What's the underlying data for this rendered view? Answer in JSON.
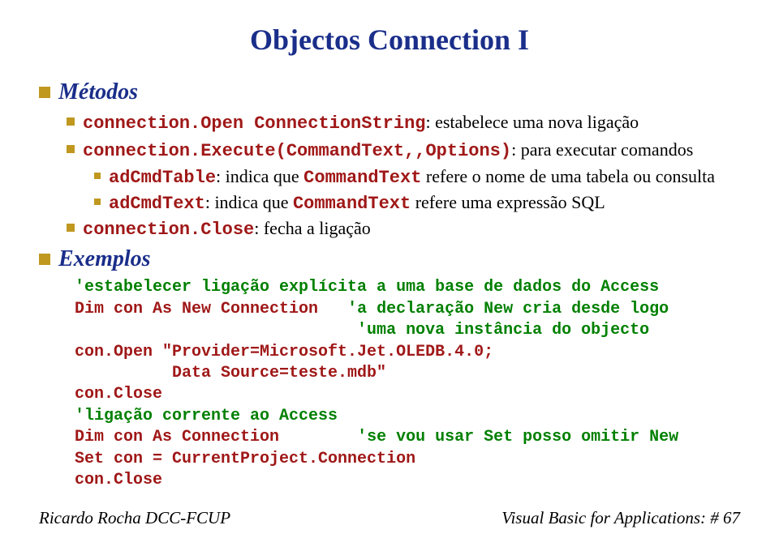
{
  "title": "Objectos Connection I",
  "section1": {
    "heading": "Métodos",
    "items": [
      {
        "prefix": "connection.Open ConnectionString",
        "rest": ": estabelece uma nova ligação"
      },
      {
        "prefix": "connection.Execute(CommandText,,Options)",
        "rest": ": para executar comandos"
      }
    ],
    "subitems": [
      {
        "prefix": "adCmdTable",
        "mid": ": indica que ",
        "mono": "CommandText",
        "rest": " refere o nome de uma tabela ou consulta"
      },
      {
        "prefix": "adCmdText",
        "mid": ": indica que ",
        "mono": "CommandText",
        "rest": " refere uma expressão SQL"
      }
    ],
    "item3": {
      "prefix": "connection.Close",
      "rest": ": fecha a ligação"
    }
  },
  "section2": {
    "heading": "Exemplos",
    "code": [
      {
        "c": "green",
        "t": "'estabelecer ligação explícita a uma base de dados do Access"
      },
      {
        "c": "mixed",
        "a": "Dim con As New Connection   ",
        "b": "'a declaração New cria desde logo"
      },
      {
        "c": "green",
        "t": "                             'uma nova instância do objecto"
      },
      {
        "c": "red",
        "t": "con.Open \"Provider=Microsoft.Jet.OLEDB.4.0;"
      },
      {
        "c": "red",
        "t": "          Data Source=teste.mdb\""
      },
      {
        "c": "red",
        "t": "con.Close"
      },
      {
        "c": "green",
        "t": "'ligação corrente ao Access"
      },
      {
        "c": "mixed",
        "a": "Dim con As Connection        ",
        "b": "'se vou usar Set posso omitir New"
      },
      {
        "c": "red",
        "t": "Set con = CurrentProject.Connection"
      },
      {
        "c": "red",
        "t": "con.Close"
      }
    ]
  },
  "footer": {
    "left": "Ricardo Rocha DCC-FCUP",
    "right": "Visual Basic for Applications: # 67"
  }
}
